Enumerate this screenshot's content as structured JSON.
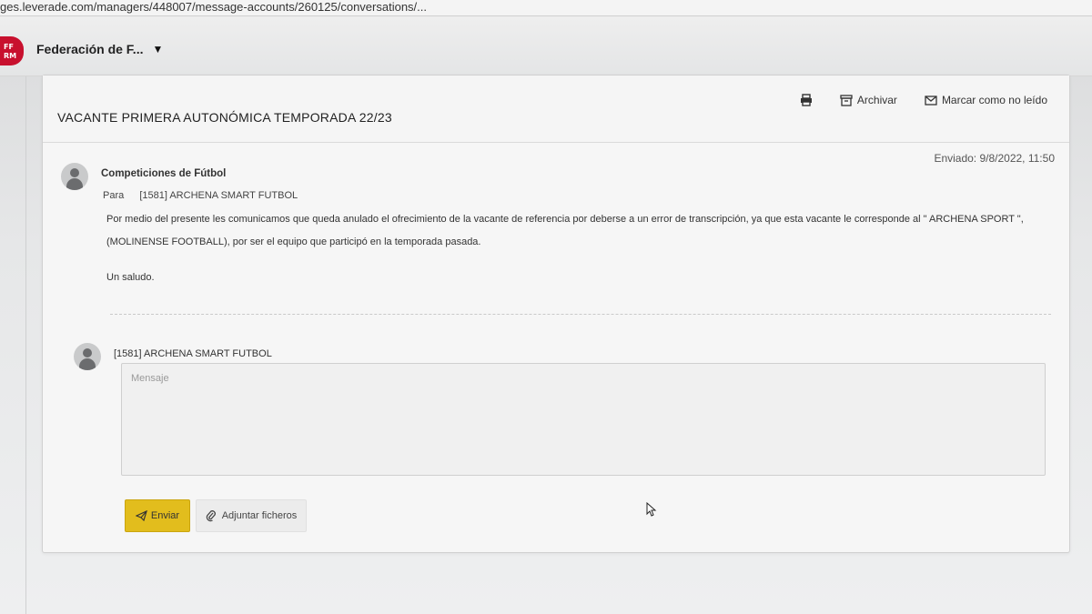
{
  "browser": {
    "url": "ges.leverade.com/managers/448007/message-accounts/260125/conversations/..."
  },
  "header": {
    "org_name": "Federación de F...",
    "caret": "▼",
    "logo_icon": "federation-logo"
  },
  "message": {
    "subject": "VACANTE PRIMERA AUTONÓMICA TEMPORADA 22/23",
    "actions": {
      "print_icon": "printer-icon",
      "archive_label": "Archivar",
      "mark_unread_label": "Marcar como no leído"
    },
    "sent": "Enviado: 9/8/2022, 11:50",
    "sender": "Competiciones de Fútbol",
    "to_label": "Para",
    "to_value": "[1581] ARCHENA SMART FUTBOL",
    "body": [
      "Por medio del presente les comunicamos que queda anulado el ofrecimiento de la vacante de referencia por deberse a un error de transcripción, ya que esta vacante le corresponde al \" ARCHENA SPORT \", (MOLINENSE FOOTBALL), por ser el equipo que participó en la temporada pasada.",
      "Un saludo."
    ]
  },
  "reply": {
    "from": "[1581] ARCHENA SMART FUTBOL",
    "placeholder": "Mensaje",
    "send_label": "Enviar",
    "attach_label": "Adjuntar ficheros"
  },
  "colors": {
    "send_button": "#e2bd1d",
    "logo": "#c8102e"
  }
}
